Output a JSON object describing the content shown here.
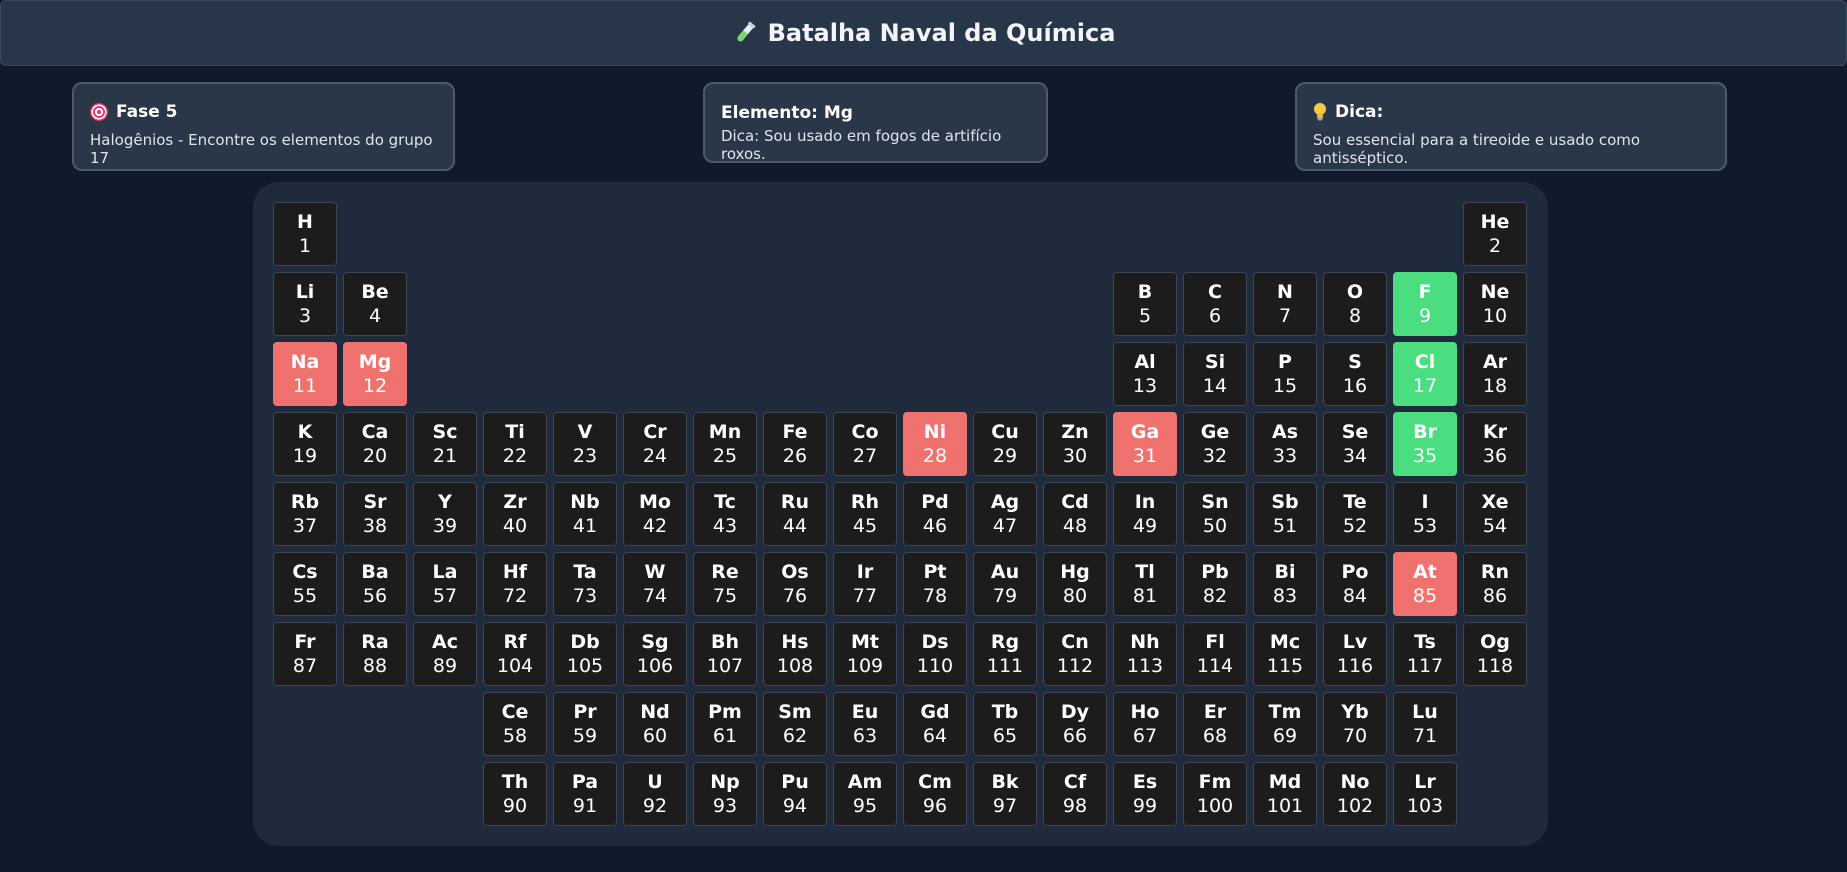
{
  "header": {
    "title": "Batalha Naval da Química",
    "icon": "test-tube-icon"
  },
  "fase_card": {
    "title": "Fase 5",
    "icon": "target-icon",
    "text": "Halogênios - Encontre os elementos do grupo 17"
  },
  "element_card": {
    "title": "Elemento: Mg",
    "text": "Dica: Sou usado em fogos de artifício roxos."
  },
  "dica_card": {
    "title": "Dica:",
    "icon": "lightbulb-icon",
    "text": "Sou essencial para a tireoide e usado como antisséptico."
  },
  "colors": {
    "hit": "#4ade80",
    "miss": "#f0726f",
    "cell": "#1c1c1c",
    "board": "#1f2a3c",
    "background": "#111a2c"
  },
  "elements": [
    {
      "s": "H",
      "n": "1",
      "r": 1,
      "c": 1
    },
    {
      "s": "He",
      "n": "2",
      "r": 1,
      "c": 18
    },
    {
      "s": "Li",
      "n": "3",
      "r": 2,
      "c": 1
    },
    {
      "s": "Be",
      "n": "4",
      "r": 2,
      "c": 2
    },
    {
      "s": "B",
      "n": "5",
      "r": 2,
      "c": 13
    },
    {
      "s": "C",
      "n": "6",
      "r": 2,
      "c": 14
    },
    {
      "s": "N",
      "n": "7",
      "r": 2,
      "c": 15
    },
    {
      "s": "O",
      "n": "8",
      "r": 2,
      "c": 16
    },
    {
      "s": "F",
      "n": "9",
      "r": 2,
      "c": 17,
      "state": "hit"
    },
    {
      "s": "Ne",
      "n": "10",
      "r": 2,
      "c": 18
    },
    {
      "s": "Na",
      "n": "11",
      "r": 3,
      "c": 1,
      "state": "miss"
    },
    {
      "s": "Mg",
      "n": "12",
      "r": 3,
      "c": 2,
      "state": "miss"
    },
    {
      "s": "Al",
      "n": "13",
      "r": 3,
      "c": 13
    },
    {
      "s": "Si",
      "n": "14",
      "r": 3,
      "c": 14
    },
    {
      "s": "P",
      "n": "15",
      "r": 3,
      "c": 15
    },
    {
      "s": "S",
      "n": "16",
      "r": 3,
      "c": 16
    },
    {
      "s": "Cl",
      "n": "17",
      "r": 3,
      "c": 17,
      "state": "hit"
    },
    {
      "s": "Ar",
      "n": "18",
      "r": 3,
      "c": 18
    },
    {
      "s": "K",
      "n": "19",
      "r": 4,
      "c": 1
    },
    {
      "s": "Ca",
      "n": "20",
      "r": 4,
      "c": 2
    },
    {
      "s": "Sc",
      "n": "21",
      "r": 4,
      "c": 3
    },
    {
      "s": "Ti",
      "n": "22",
      "r": 4,
      "c": 4
    },
    {
      "s": "V",
      "n": "23",
      "r": 4,
      "c": 5
    },
    {
      "s": "Cr",
      "n": "24",
      "r": 4,
      "c": 6
    },
    {
      "s": "Mn",
      "n": "25",
      "r": 4,
      "c": 7
    },
    {
      "s": "Fe",
      "n": "26",
      "r": 4,
      "c": 8
    },
    {
      "s": "Co",
      "n": "27",
      "r": 4,
      "c": 9
    },
    {
      "s": "Ni",
      "n": "28",
      "r": 4,
      "c": 10,
      "state": "miss"
    },
    {
      "s": "Cu",
      "n": "29",
      "r": 4,
      "c": 11
    },
    {
      "s": "Zn",
      "n": "30",
      "r": 4,
      "c": 12
    },
    {
      "s": "Ga",
      "n": "31",
      "r": 4,
      "c": 13,
      "state": "miss"
    },
    {
      "s": "Ge",
      "n": "32",
      "r": 4,
      "c": 14
    },
    {
      "s": "As",
      "n": "33",
      "r": 4,
      "c": 15
    },
    {
      "s": "Se",
      "n": "34",
      "r": 4,
      "c": 16
    },
    {
      "s": "Br",
      "n": "35",
      "r": 4,
      "c": 17,
      "state": "hit"
    },
    {
      "s": "Kr",
      "n": "36",
      "r": 4,
      "c": 18
    },
    {
      "s": "Rb",
      "n": "37",
      "r": 5,
      "c": 1
    },
    {
      "s": "Sr",
      "n": "38",
      "r": 5,
      "c": 2
    },
    {
      "s": "Y",
      "n": "39",
      "r": 5,
      "c": 3
    },
    {
      "s": "Zr",
      "n": "40",
      "r": 5,
      "c": 4
    },
    {
      "s": "Nb",
      "n": "41",
      "r": 5,
      "c": 5
    },
    {
      "s": "Mo",
      "n": "42",
      "r": 5,
      "c": 6
    },
    {
      "s": "Tc",
      "n": "43",
      "r": 5,
      "c": 7
    },
    {
      "s": "Ru",
      "n": "44",
      "r": 5,
      "c": 8
    },
    {
      "s": "Rh",
      "n": "45",
      "r": 5,
      "c": 9
    },
    {
      "s": "Pd",
      "n": "46",
      "r": 5,
      "c": 10
    },
    {
      "s": "Ag",
      "n": "47",
      "r": 5,
      "c": 11
    },
    {
      "s": "Cd",
      "n": "48",
      "r": 5,
      "c": 12
    },
    {
      "s": "In",
      "n": "49",
      "r": 5,
      "c": 13
    },
    {
      "s": "Sn",
      "n": "50",
      "r": 5,
      "c": 14
    },
    {
      "s": "Sb",
      "n": "51",
      "r": 5,
      "c": 15
    },
    {
      "s": "Te",
      "n": "52",
      "r": 5,
      "c": 16
    },
    {
      "s": "I",
      "n": "53",
      "r": 5,
      "c": 17
    },
    {
      "s": "Xe",
      "n": "54",
      "r": 5,
      "c": 18
    },
    {
      "s": "Cs",
      "n": "55",
      "r": 6,
      "c": 1
    },
    {
      "s": "Ba",
      "n": "56",
      "r": 6,
      "c": 2
    },
    {
      "s": "La",
      "n": "57",
      "r": 6,
      "c": 3
    },
    {
      "s": "Hf",
      "n": "72",
      "r": 6,
      "c": 4
    },
    {
      "s": "Ta",
      "n": "73",
      "r": 6,
      "c": 5
    },
    {
      "s": "W",
      "n": "74",
      "r": 6,
      "c": 6
    },
    {
      "s": "Re",
      "n": "75",
      "r": 6,
      "c": 7
    },
    {
      "s": "Os",
      "n": "76",
      "r": 6,
      "c": 8
    },
    {
      "s": "Ir",
      "n": "77",
      "r": 6,
      "c": 9
    },
    {
      "s": "Pt",
      "n": "78",
      "r": 6,
      "c": 10
    },
    {
      "s": "Au",
      "n": "79",
      "r": 6,
      "c": 11
    },
    {
      "s": "Hg",
      "n": "80",
      "r": 6,
      "c": 12
    },
    {
      "s": "Tl",
      "n": "81",
      "r": 6,
      "c": 13
    },
    {
      "s": "Pb",
      "n": "82",
      "r": 6,
      "c": 14
    },
    {
      "s": "Bi",
      "n": "83",
      "r": 6,
      "c": 15
    },
    {
      "s": "Po",
      "n": "84",
      "r": 6,
      "c": 16
    },
    {
      "s": "At",
      "n": "85",
      "r": 6,
      "c": 17,
      "state": "miss"
    },
    {
      "s": "Rn",
      "n": "86",
      "r": 6,
      "c": 18
    },
    {
      "s": "Fr",
      "n": "87",
      "r": 7,
      "c": 1
    },
    {
      "s": "Ra",
      "n": "88",
      "r": 7,
      "c": 2
    },
    {
      "s": "Ac",
      "n": "89",
      "r": 7,
      "c": 3
    },
    {
      "s": "Rf",
      "n": "104",
      "r": 7,
      "c": 4
    },
    {
      "s": "Db",
      "n": "105",
      "r": 7,
      "c": 5
    },
    {
      "s": "Sg",
      "n": "106",
      "r": 7,
      "c": 6
    },
    {
      "s": "Bh",
      "n": "107",
      "r": 7,
      "c": 7
    },
    {
      "s": "Hs",
      "n": "108",
      "r": 7,
      "c": 8
    },
    {
      "s": "Mt",
      "n": "109",
      "r": 7,
      "c": 9
    },
    {
      "s": "Ds",
      "n": "110",
      "r": 7,
      "c": 10
    },
    {
      "s": "Rg",
      "n": "111",
      "r": 7,
      "c": 11
    },
    {
      "s": "Cn",
      "n": "112",
      "r": 7,
      "c": 12
    },
    {
      "s": "Nh",
      "n": "113",
      "r": 7,
      "c": 13
    },
    {
      "s": "Fl",
      "n": "114",
      "r": 7,
      "c": 14
    },
    {
      "s": "Mc",
      "n": "115",
      "r": 7,
      "c": 15
    },
    {
      "s": "Lv",
      "n": "116",
      "r": 7,
      "c": 16
    },
    {
      "s": "Ts",
      "n": "117",
      "r": 7,
      "c": 17
    },
    {
      "s": "Og",
      "n": "118",
      "r": 7,
      "c": 18
    },
    {
      "s": "Ce",
      "n": "58",
      "r": 8,
      "c": 4
    },
    {
      "s": "Pr",
      "n": "59",
      "r": 8,
      "c": 5
    },
    {
      "s": "Nd",
      "n": "60",
      "r": 8,
      "c": 6
    },
    {
      "s": "Pm",
      "n": "61",
      "r": 8,
      "c": 7
    },
    {
      "s": "Sm",
      "n": "62",
      "r": 8,
      "c": 8
    },
    {
      "s": "Eu",
      "n": "63",
      "r": 8,
      "c": 9
    },
    {
      "s": "Gd",
      "n": "64",
      "r": 8,
      "c": 10
    },
    {
      "s": "Tb",
      "n": "65",
      "r": 8,
      "c": 11
    },
    {
      "s": "Dy",
      "n": "66",
      "r": 8,
      "c": 12
    },
    {
      "s": "Ho",
      "n": "67",
      "r": 8,
      "c": 13
    },
    {
      "s": "Er",
      "n": "68",
      "r": 8,
      "c": 14
    },
    {
      "s": "Tm",
      "n": "69",
      "r": 8,
      "c": 15
    },
    {
      "s": "Yb",
      "n": "70",
      "r": 8,
      "c": 16
    },
    {
      "s": "Lu",
      "n": "71",
      "r": 8,
      "c": 17
    },
    {
      "s": "Th",
      "n": "90",
      "r": 9,
      "c": 4
    },
    {
      "s": "Pa",
      "n": "91",
      "r": 9,
      "c": 5
    },
    {
      "s": "U",
      "n": "92",
      "r": 9,
      "c": 6
    },
    {
      "s": "Np",
      "n": "93",
      "r": 9,
      "c": 7
    },
    {
      "s": "Pu",
      "n": "94",
      "r": 9,
      "c": 8
    },
    {
      "s": "Am",
      "n": "95",
      "r": 9,
      "c": 9
    },
    {
      "s": "Cm",
      "n": "96",
      "r": 9,
      "c": 10
    },
    {
      "s": "Bk",
      "n": "97",
      "r": 9,
      "c": 11
    },
    {
      "s": "Cf",
      "n": "98",
      "r": 9,
      "c": 12
    },
    {
      "s": "Es",
      "n": "99",
      "r": 9,
      "c": 13
    },
    {
      "s": "Fm",
      "n": "100",
      "r": 9,
      "c": 14
    },
    {
      "s": "Md",
      "n": "101",
      "r": 9,
      "c": 15
    },
    {
      "s": "No",
      "n": "102",
      "r": 9,
      "c": 16
    },
    {
      "s": "Lr",
      "n": "103",
      "r": 9,
      "c": 17
    }
  ]
}
